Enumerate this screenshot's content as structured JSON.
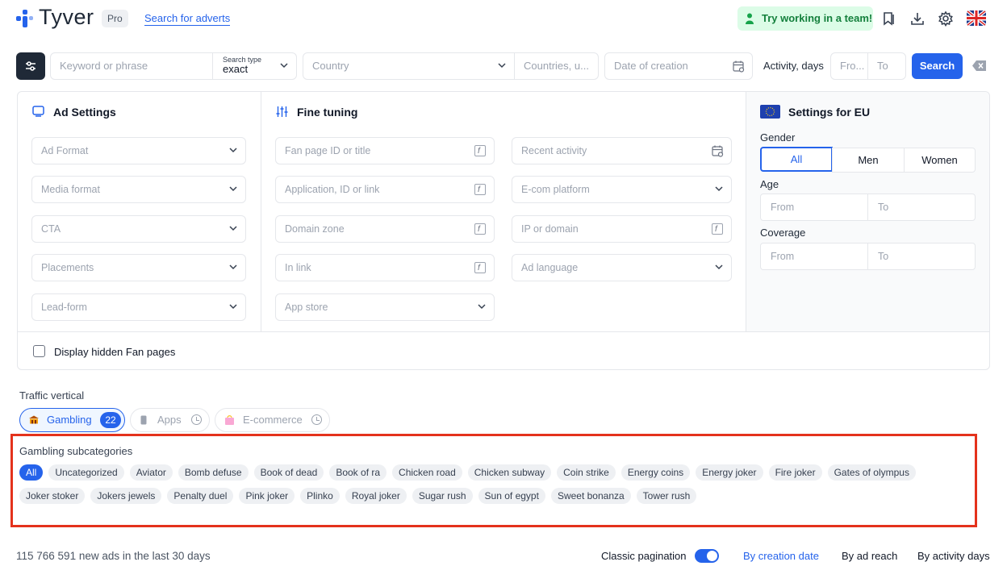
{
  "header": {
    "logo_text": "Tyver",
    "pro_badge": "Pro",
    "search_adverts_link": "Search for adverts",
    "team_button": "Try working in a team!",
    "icons": [
      "bookmark-icon",
      "download-icon",
      "gear-icon",
      "uk-flag-icon"
    ]
  },
  "searchbar": {
    "keyword_placeholder": "Keyword or phrase",
    "search_type_label": "Search type",
    "search_type_value": "exact",
    "country_placeholder": "Country",
    "countries_placeholder": "Countries, u...",
    "date_placeholder": "Date of creation",
    "activity_label": "Activity, days",
    "activity_from": "Fro...",
    "activity_to": "To",
    "search_button": "Search"
  },
  "ad_settings": {
    "title": "Ad Settings",
    "fields": [
      "Ad Format",
      "Media format",
      "CTA",
      "Placements",
      "Lead-form"
    ]
  },
  "fine_tuning": {
    "title": "Fine tuning",
    "col1": [
      "Fan page ID or title",
      "Application, ID or link",
      "Domain zone",
      "In link",
      "App store"
    ],
    "col2": [
      "Recent activity",
      "E-com platform",
      "IP or domain",
      "Ad language"
    ]
  },
  "eu_settings": {
    "title": "Settings for EU",
    "gender_label": "Gender",
    "gender_options": [
      "All",
      "Men",
      "Women"
    ],
    "gender_selected": "All",
    "age_label": "Age",
    "age_from": "From",
    "age_to": "To",
    "coverage_label": "Coverage",
    "coverage_from": "From",
    "coverage_to": "To"
  },
  "hidden_fanpages_label": "Display hidden Fan pages",
  "traffic_vertical": {
    "label": "Traffic vertical",
    "tabs": [
      {
        "label": "Gambling",
        "count": "22",
        "active": true
      },
      {
        "label": "Apps",
        "active": false
      },
      {
        "label": "E-commerce",
        "active": false
      }
    ]
  },
  "gambling_subcategories": {
    "label": "Gambling subcategories",
    "items": [
      "All",
      "Uncategorized",
      "Aviator",
      "Bomb defuse",
      "Book of dead",
      "Book of ra",
      "Chicken road",
      "Chicken subway",
      "Coin strike",
      "Energy coins",
      "Energy joker",
      "Fire joker",
      "Gates of olympus",
      "Joker stoker",
      "Jokers jewels",
      "Penalty duel",
      "Pink joker",
      "Plinko",
      "Royal joker",
      "Sugar rush",
      "Sun of egypt",
      "Sweet bonanza",
      "Tower rush"
    ],
    "selected": "All"
  },
  "footer": {
    "new_ads_text": "115 766 591 new ads in the last 30 days",
    "classic_pagination": "Classic pagination",
    "sort_options": [
      "By creation date",
      "By ad reach",
      "By activity days"
    ],
    "sort_selected": "By creation date"
  },
  "colors": {
    "accent": "#2563eb",
    "highlight_border": "#e4321c",
    "team_bg": "#dcfce7",
    "team_text": "#15803d"
  }
}
